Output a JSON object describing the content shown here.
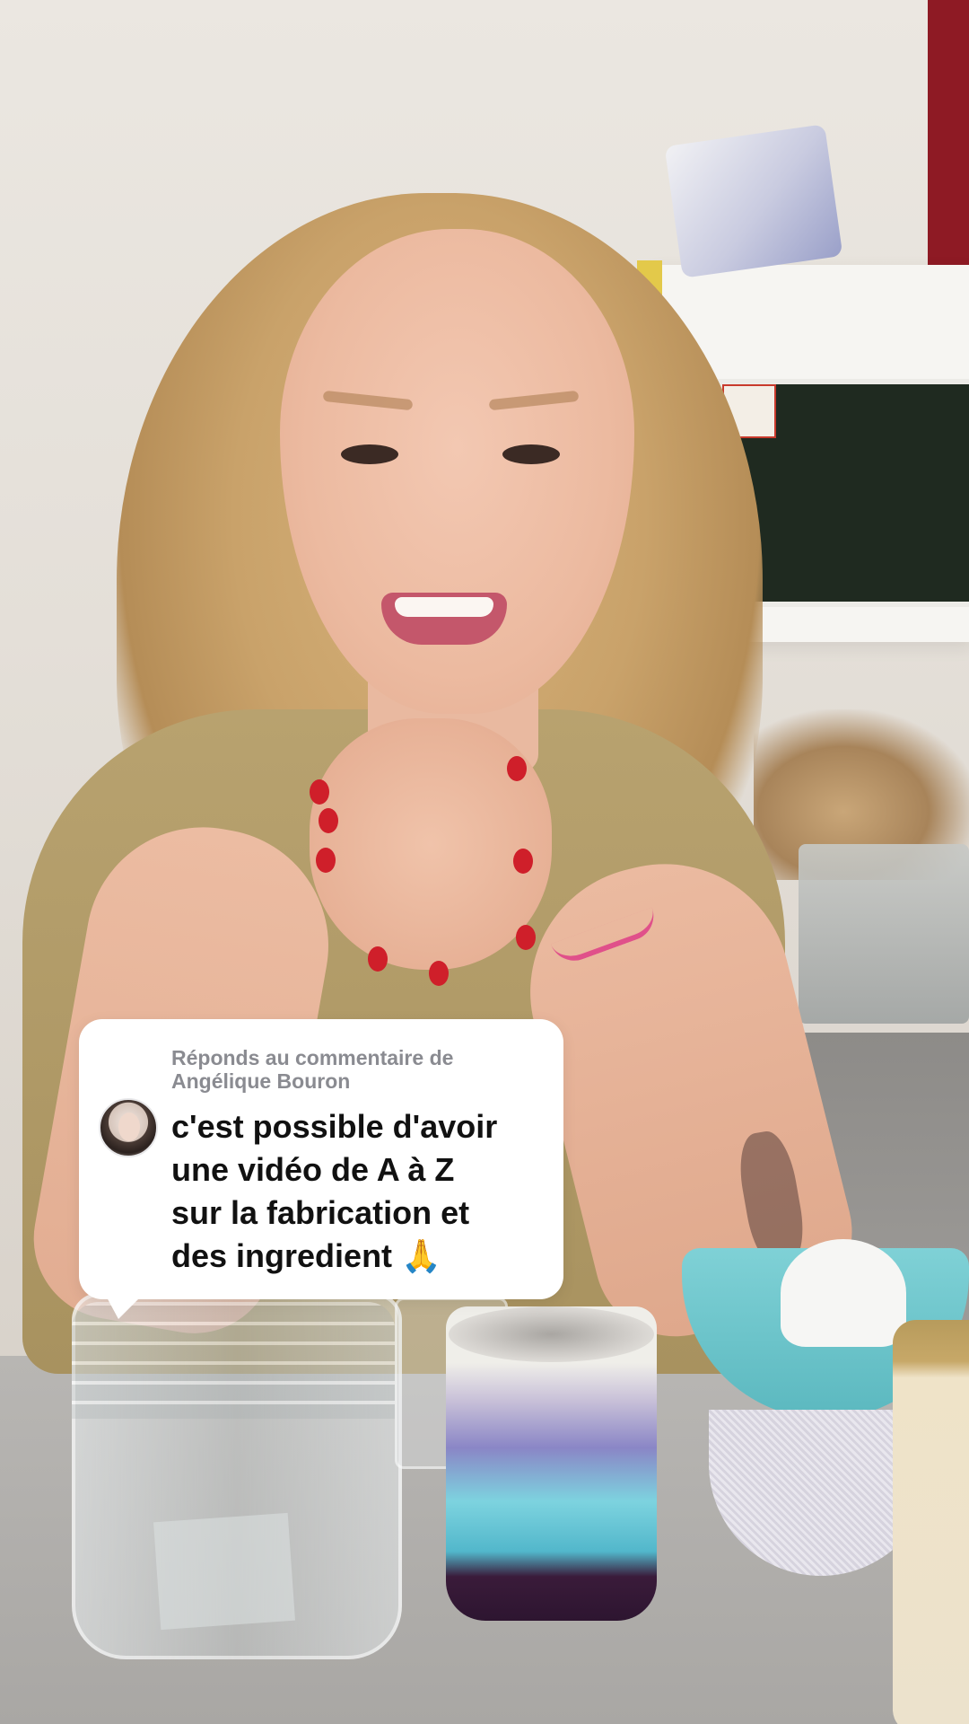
{
  "comment_reply": {
    "header_line1": "Réponds au commentaire de",
    "header_line2": "Angélique Bouron",
    "comment_lines": [
      "c'est possible d'avoir",
      "une vidéo de A à Z",
      "sur la fabrication et",
      "des ingredient 🙏"
    ]
  },
  "icons": {
    "avatar": "commenter-avatar",
    "emoji": "folded-hands"
  }
}
